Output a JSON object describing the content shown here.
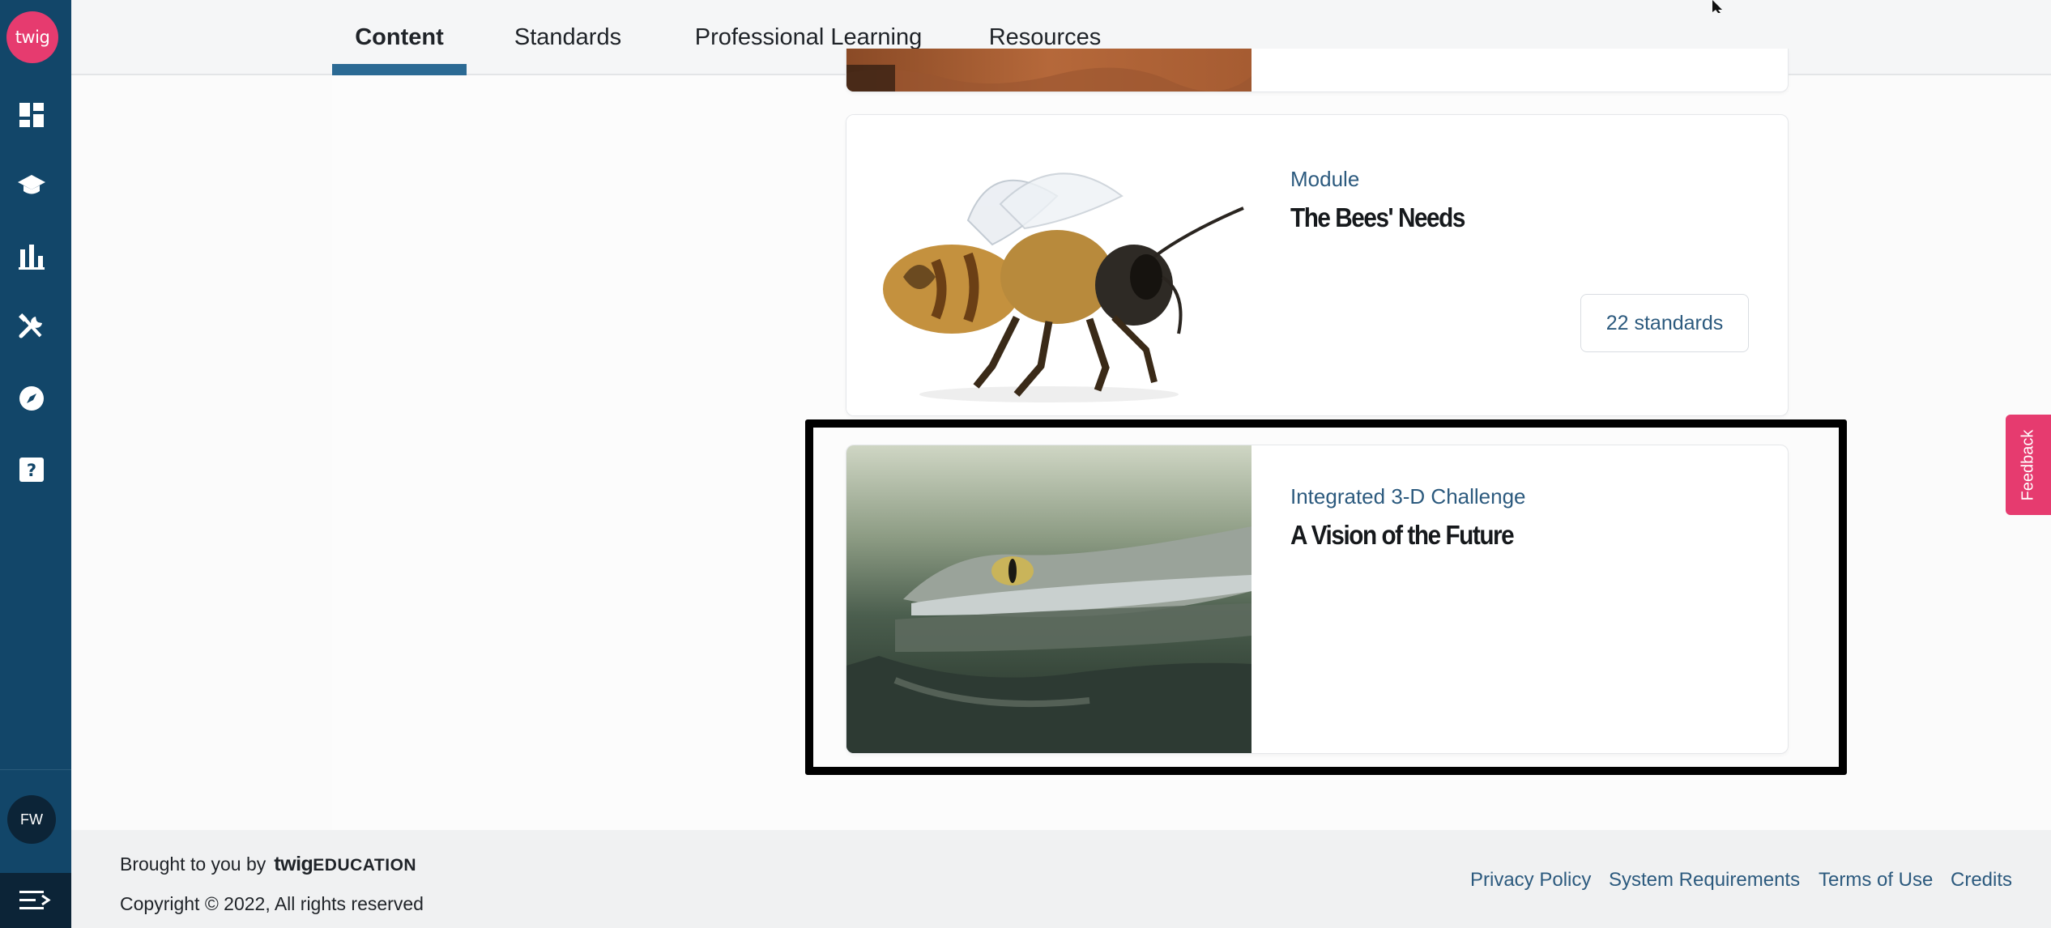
{
  "app": {
    "logo_text": "twig",
    "user_initials": "FW"
  },
  "sidebar": {
    "items": [
      {
        "icon": "dashboard-icon"
      },
      {
        "icon": "graduation-cap-icon"
      },
      {
        "icon": "bar-chart-icon"
      },
      {
        "icon": "tools-icon"
      },
      {
        "icon": "compass-icon"
      },
      {
        "icon": "help-icon"
      }
    ],
    "menu_icon": "menu-collapse-icon"
  },
  "header": {
    "tabs": [
      {
        "label": "Content",
        "active": true
      },
      {
        "label": "Standards",
        "active": false
      },
      {
        "label": "Professional Learning",
        "active": false
      },
      {
        "label": "Resources",
        "active": false
      }
    ]
  },
  "cards": [
    {
      "type": "Module",
      "title": "The Bees' Needs",
      "standards": "22 standards"
    },
    {
      "type": "Integrated 3-D Challenge",
      "title": "A Vision of the Future"
    }
  ],
  "feedback": {
    "label": "Feedback"
  },
  "footer": {
    "brought_by": "Brought to you by",
    "brand": "twig",
    "brand_sub": "EDUCATION",
    "copyright": "Copyright © 2022, All rights reserved",
    "links": [
      "Privacy Policy",
      "System Requirements",
      "Terms of Use",
      "Credits"
    ]
  },
  "colors": {
    "sidebar": "#124669",
    "brand_pink": "#e63b6f",
    "accent_blue": "#2b6a94",
    "link": "#2c5a7e"
  }
}
